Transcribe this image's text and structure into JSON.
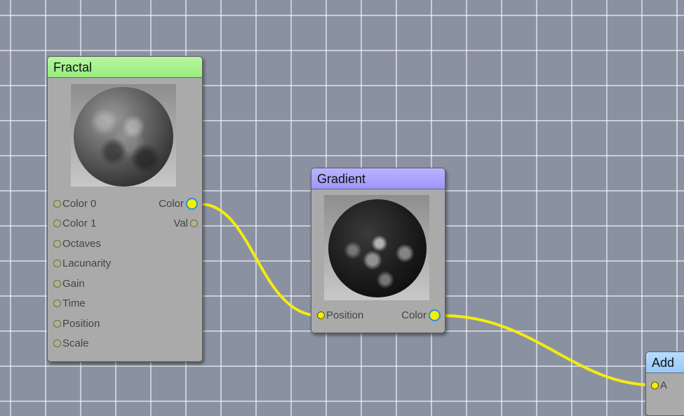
{
  "canvas": {
    "grid_color": "#ffffff",
    "background_color": "#8a92a2",
    "wire_color": "#f5eb10"
  },
  "nodes": {
    "fractal": {
      "title": "Fractal",
      "header_color": "#9cee82",
      "inputs": [
        "Color 0",
        "Color 1",
        "Octaves",
        "Lacunarity",
        "Gain",
        "Time",
        "Position",
        "Scale"
      ],
      "outputs": [
        "Color",
        "Val"
      ]
    },
    "gradient": {
      "title": "Gradient",
      "header_color": "#a29cfb",
      "inputs": [
        "Position"
      ],
      "outputs": [
        "Color"
      ]
    },
    "add": {
      "title": "Add",
      "header_color": "#9ccaf8",
      "inputs": [
        "A"
      ]
    }
  },
  "connections": [
    {
      "from": "Fractal.Color",
      "to": "Gradient.Position"
    },
    {
      "from": "Gradient.Color",
      "to": "Add.A"
    }
  ]
}
